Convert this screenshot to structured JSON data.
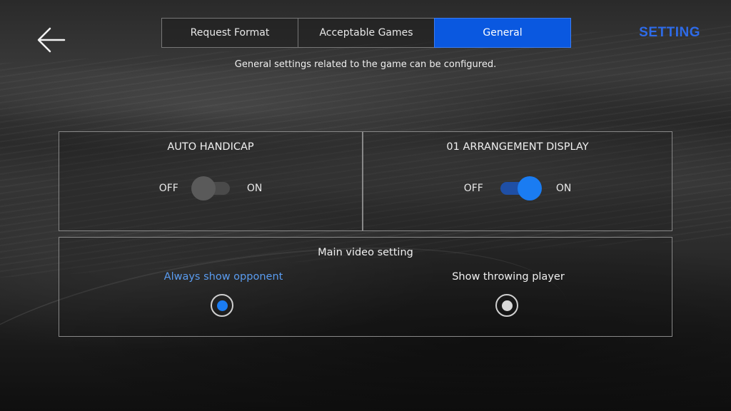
{
  "header": {
    "back_icon": "arrow-left-icon",
    "title": "SETTING",
    "tabs": [
      {
        "label": "Request Format",
        "active": false
      },
      {
        "label": "Acceptable Games",
        "active": false
      },
      {
        "label": "General",
        "active": true
      }
    ],
    "description": "General settings related to the game can be configured."
  },
  "auto_handicap": {
    "title": "AUTO HANDICAP",
    "off_label": "OFF",
    "on_label": "ON",
    "state": "off"
  },
  "arrangement_display": {
    "title": "01 ARRANGEMENT DISPLAY",
    "off_label": "OFF",
    "on_label": "ON",
    "state": "on"
  },
  "video_setting": {
    "title": "Main video setting",
    "options": [
      {
        "label": "Always show opponent",
        "selected": true
      },
      {
        "label": "Show throwing player",
        "selected": false
      }
    ]
  },
  "colors": {
    "accent": "#0a58e0",
    "title_blue": "#2e6be8",
    "selected_label": "#5a9cf0",
    "toggle_on": "#1a7cf2"
  }
}
